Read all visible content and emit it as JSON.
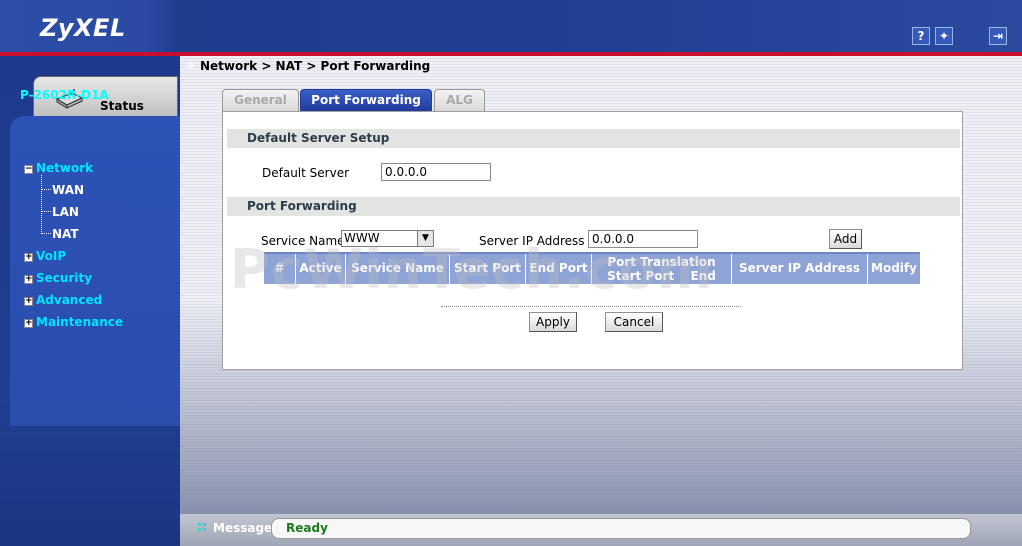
{
  "header": {
    "logo": "ZyXEL",
    "help_label": "?",
    "wizard_label": "✦",
    "logout_label": "⇥"
  },
  "breadcrumb": "Network > NAT > Port Forwarding",
  "sidebar": {
    "status_label": "Status",
    "device": "P-2602R-D1A",
    "items": [
      {
        "label": "Network",
        "toggle": "−"
      },
      {
        "label": "VoIP",
        "toggle": "+"
      },
      {
        "label": "Security",
        "toggle": "+"
      },
      {
        "label": "Advanced",
        "toggle": "+"
      },
      {
        "label": "Maintenance",
        "toggle": "+"
      }
    ],
    "network_sub": [
      "WAN",
      "LAN",
      "NAT"
    ]
  },
  "tabs": [
    {
      "label": "General",
      "active": false
    },
    {
      "label": "Port Forwarding",
      "active": true
    },
    {
      "label": "ALG",
      "active": false
    }
  ],
  "default_server": {
    "section_title": "Default Server Setup",
    "label": "Default Server",
    "value": "0.0.0.0"
  },
  "port_forwarding": {
    "section_title": "Port Forwarding",
    "service_label": "Service Name",
    "service_value": "WWW",
    "server_ip_label": "Server IP Address",
    "server_ip_value": "0.0.0.0",
    "add_label": "Add",
    "columns": {
      "num": "#",
      "active": "Active",
      "service": "Service Name",
      "start": "Start Port",
      "end": "End Port",
      "translation": "Port Translation",
      "t_start": "Start Port",
      "t_end": "End Port",
      "server_ip": "Server IP Address",
      "modify": "Modify"
    }
  },
  "actions": {
    "apply": "Apply",
    "cancel": "Cancel"
  },
  "watermark": "PcWinTech.com",
  "statusbar": {
    "label": "Message",
    "text": "Ready"
  }
}
